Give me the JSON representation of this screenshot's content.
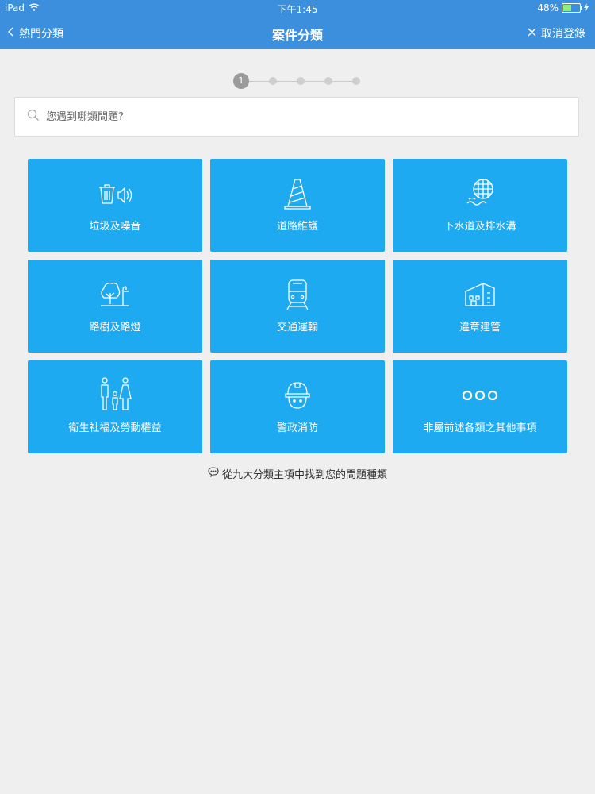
{
  "status": {
    "device": "iPad",
    "time": "下午1:45",
    "battery": "48%",
    "battery_level": 0.48
  },
  "nav": {
    "back_label": "熱門分類",
    "title": "案件分類",
    "cancel_label": "取消登錄"
  },
  "stepper": {
    "current": "1",
    "total": 5
  },
  "search": {
    "placeholder": "您遇到哪類問題?"
  },
  "categories": [
    {
      "label": "垃圾及噪音",
      "icon": "trash-noise-icon"
    },
    {
      "label": "道路維護",
      "icon": "traffic-cone-icon"
    },
    {
      "label": "下水道及排水溝",
      "icon": "sewer-drain-icon"
    },
    {
      "label": "路樹及路燈",
      "icon": "tree-streetlight-icon"
    },
    {
      "label": "交通運輸",
      "icon": "train-icon"
    },
    {
      "label": "違章建管",
      "icon": "building-icon"
    },
    {
      "label": "衛生社福及勞動權益",
      "icon": "family-icon"
    },
    {
      "label": "警政消防",
      "icon": "helmet-icon"
    },
    {
      "label": "非屬前述各類之其他事項",
      "icon": "more-dots-icon"
    }
  ],
  "hint": "從九大分類主項中找到您的問題種類"
}
